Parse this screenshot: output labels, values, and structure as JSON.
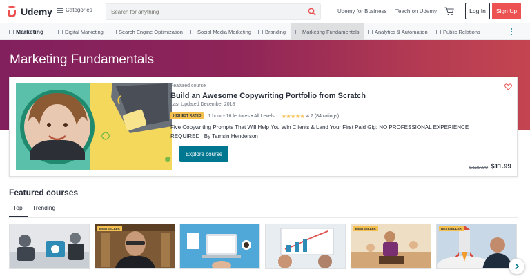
{
  "brand": {
    "name": "Udemy",
    "accent": "#ec5252",
    "primary": "#007791"
  },
  "topnav": {
    "categories_label": "Categories",
    "search_placeholder": "Search for anything",
    "business_link": "Udemy for Business",
    "teach_link": "Teach on Udemy",
    "login_label": "Log In",
    "signup_label": "Sign Up"
  },
  "subnav": {
    "items": [
      {
        "label": "Marketing",
        "icon": "marketing-icon"
      },
      {
        "label": "Digital Marketing",
        "icon": "digital-marketing-icon"
      },
      {
        "label": "Search Engine Optimization",
        "icon": "seo-icon"
      },
      {
        "label": "Social Media Marketing",
        "icon": "social-media-icon"
      },
      {
        "label": "Branding",
        "icon": "branding-icon"
      },
      {
        "label": "Marketing Fundamentals",
        "icon": "marketing-fundamentals-icon"
      },
      {
        "label": "Analytics & Automation",
        "icon": "analytics-icon"
      },
      {
        "label": "Public Relations",
        "icon": "public-relations-icon"
      }
    ],
    "active_index": 5
  },
  "hero": {
    "title": "Marketing Fundamentals"
  },
  "featured": {
    "label": "Featured course",
    "title": "Build an Awesome Copywriting Portfolio from Scratch",
    "updated": "Last Updated December 2018",
    "badge": "HIGHEST RATED",
    "meta": "1 hour • 16 lectures • All Levels",
    "stars": "★★★★★",
    "rating": "4.7 (84 ratings)",
    "description": "Five Copywriting Prompts That Will Help You Win Clients & Land Your First Paid Gig: NO PROFESSIONAL EXPERIENCE REQUIRED | By Tamsin Henderson",
    "button_label": "Explore course",
    "price_old": "$129.99",
    "price_new": "$11.99"
  },
  "courses": {
    "title": "Featured courses",
    "tabs": [
      "Top",
      "Trending"
    ],
    "active_tab": 0,
    "thumbs": [
      {
        "bestseller": false
      },
      {
        "bestseller": true,
        "badge": "BESTSELLER"
      },
      {
        "bestseller": false
      },
      {
        "bestseller": false
      },
      {
        "bestseller": true,
        "badge": "BESTSELLER"
      },
      {
        "bestseller": true,
        "badge": "BESTSELLER"
      }
    ]
  }
}
